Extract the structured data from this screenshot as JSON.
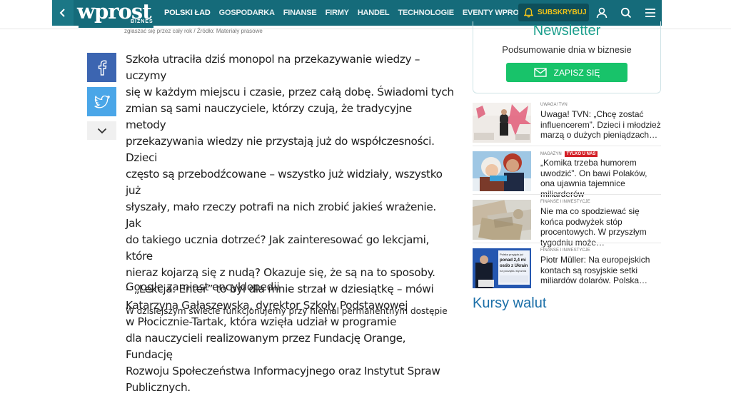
{
  "header": {
    "logo": "wprost",
    "logo_sub": "BIZNES",
    "nav": [
      {
        "label": "POLSKI ŁAD"
      },
      {
        "label": "GOSPODARKA"
      },
      {
        "label": "FINANSE"
      },
      {
        "label": "FIRMY"
      },
      {
        "label": "HANDEL"
      },
      {
        "label": "TECHNOLOGIE"
      },
      {
        "label": "EVENTY WPROST"
      }
    ],
    "subscribe_label": "SUBSKRYBUJ",
    "icons": [
      "chevron-left-icon",
      "bell-icon",
      "user-icon",
      "search-icon",
      "menu-icon"
    ],
    "colors": {
      "bar": "#156b7a",
      "subscribe_text": "#f5c518"
    }
  },
  "caption": "zgłaszać się przez cały rok / Źródło: Materiały prasowe",
  "share": {
    "icons": [
      "facebook-icon",
      "twitter-icon",
      "chevron-down-icon"
    ],
    "colors": {
      "facebook": "#3c65b1",
      "twitter": "#4aa6e8"
    }
  },
  "article": {
    "lines": [
      "Szkoła utraciła dziś monopol na przekazywanie wiedzy – uczymy",
      "się w każdym miejscu i czasie, przez całą dobę. Świadomi tych",
      "zmian są sami nauczyciele, którzy czują, że tradycyjne metody",
      "przekazywania wiedzy nie przystają już do współczesności. Dzieci",
      "często są przebodźcowane – wszystko już widziały, wszystko już",
      "słyszały, mało rzeczy potrafi na nich zrobić jakieś wrażenie. Jak",
      "do takiego ucznia dotrzeć? Jak zainteresować go lekcjami, które",
      "nieraz kojarzą się z nudą? Okazuje się, że są na to sposoby.",
      "– „Lekcja: Enter” to był dla mnie strzał w dziesiątkę – mówi",
      "Katarzyna Gałaszewska, dyrektor Szkoły Podstawowej",
      "w Płocicznie-Tartak, która wzięła udział w programie",
      "dla nauczycieli realizowanym przez Fundację Orange, Fundację",
      "Rozwoju Społeczeństwa Informacyjnego oraz Instytut Spraw",
      "Publicznych."
    ],
    "subheading": "Google zamiast encyklopedii",
    "paragraph2": "W dzisiejszym świecie funkcjonujemy przy niemal permanentnym dostępie"
  },
  "newsletter": {
    "title": "Newsletter",
    "subtitle": "Podsumowanie dnia w biznesie",
    "button": "ZAPISZ SIĘ",
    "colors": {
      "title": "#1a9e8c",
      "button": "#18c36a"
    }
  },
  "related": [
    {
      "tag": "UWAGA! TVN",
      "badge": "",
      "title": "Uwaga! TVN: „Chcę zostać influencerem”. Dzieci i młodzież marzą o dużych pieniądzach…"
    },
    {
      "tag": "MAGAZYN",
      "badge": "TYLKO U NAS",
      "title": "„Komika trzeba humorem uwodzić”. On bawi Polaków, ona ujawnia tajemnice miliarderów"
    },
    {
      "tag": "FINANSE I INWESTYCJE",
      "badge": "",
      "title": "Nie ma co spodziewać się końca podwyżek stóp procentowych. W przyszłym tygodniu może…"
    },
    {
      "tag": "FINANSE I INWESTYCJE",
      "badge": "",
      "title": "Piotr Müller: Na europejskich kontach są rosyjskie setki miliardów dolarów. Polska…"
    }
  ],
  "thumb_text": {
    "fourth": [
      "Polska przyjęła już",
      "ponad 2,4 mi",
      "osób z Ukrain",
      "na początku stycznia"
    ]
  },
  "kursy": "Kursy walut"
}
